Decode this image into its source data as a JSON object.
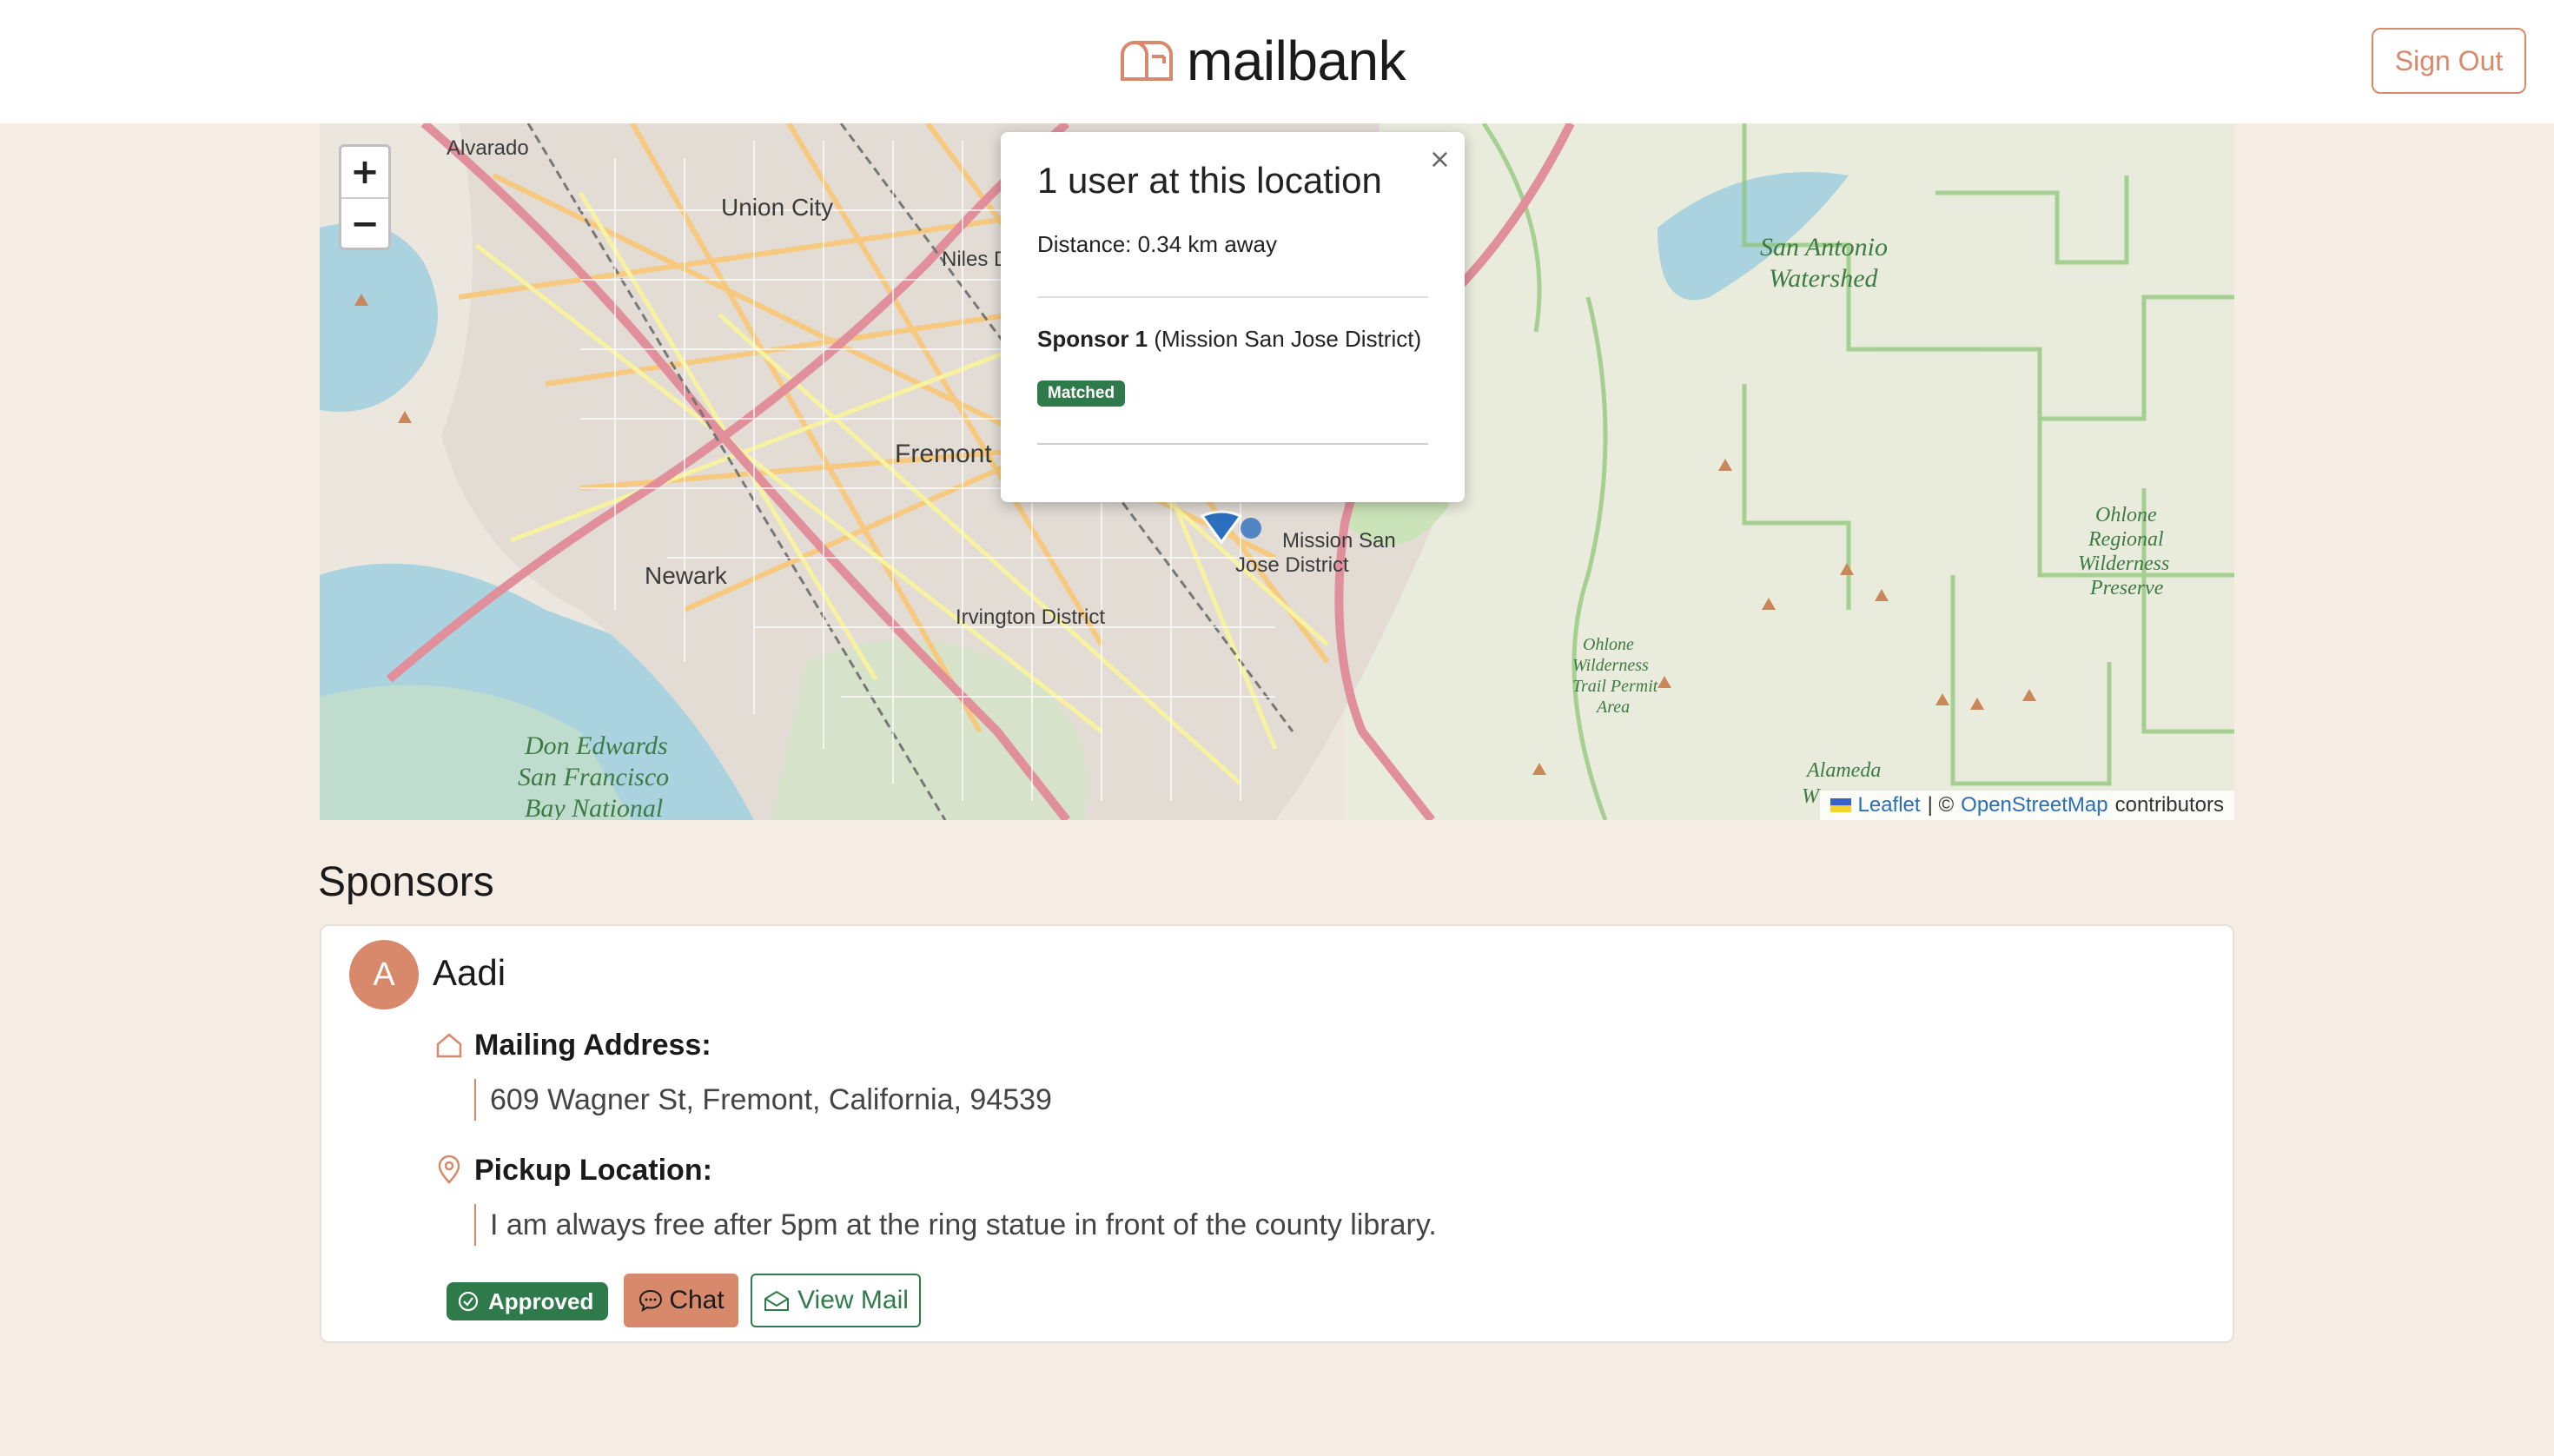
{
  "header": {
    "brand": "mailbank",
    "sign_out": "Sign Out"
  },
  "map": {
    "zoom_in": "+",
    "zoom_out": "−",
    "labels": {
      "alvarado": "Alvarado",
      "union_city": "Union City",
      "niles": "Niles D",
      "fremont": "Fremont",
      "newark": "Newark",
      "irvington": "Irvington District",
      "mission_sj_1": "Mission San",
      "mission_sj_2": "Jose District",
      "sa_watershed_1": "San Antonio",
      "sa_watershed_2": "Watershed",
      "ohlone_pres_1": "Ohlone",
      "ohlone_pres_2": "Regional",
      "ohlone_pres_3": "Wilderness",
      "ohlone_pres_4": "Preserve",
      "ohlone_trail_1": "Ohlone",
      "ohlone_trail_2": "Wilderness",
      "ohlone_trail_3": "Trail Permit",
      "ohlone_trail_4": "Area",
      "don_edwards_1": "Don Edwards",
      "don_edwards_2": "San Francisco",
      "don_edwards_3": "Bay National",
      "alameda_1": "Alameda",
      "alameda_2": "W"
    },
    "attribution": {
      "leaflet": "Leaflet",
      "sep": "| ©",
      "osm": "OpenStreetMap",
      "contributors": "contributors"
    }
  },
  "popup": {
    "title": "1 user at this location",
    "distance": "Distance: 0.34 km away",
    "sponsor_name": "Sponsor 1",
    "sponsor_area": "(Mission San Jose District)",
    "badge": "Matched",
    "close": "×"
  },
  "sponsors": {
    "title": "Sponsors",
    "items": [
      {
        "initial": "A",
        "name": "Aadi",
        "mailing_label": "Mailing Address:",
        "mailing_value": "609 Wagner St, Fremont, California, 94539",
        "pickup_label": "Pickup Location:",
        "pickup_value": "I am always free after 5pm at the ring statue in front of the county library.",
        "status": "Approved",
        "chat": "Chat",
        "view_mail": "View Mail"
      }
    ]
  },
  "colors": {
    "accent": "#d9896b",
    "success": "#2f7a4a",
    "background": "#f5ede3"
  }
}
